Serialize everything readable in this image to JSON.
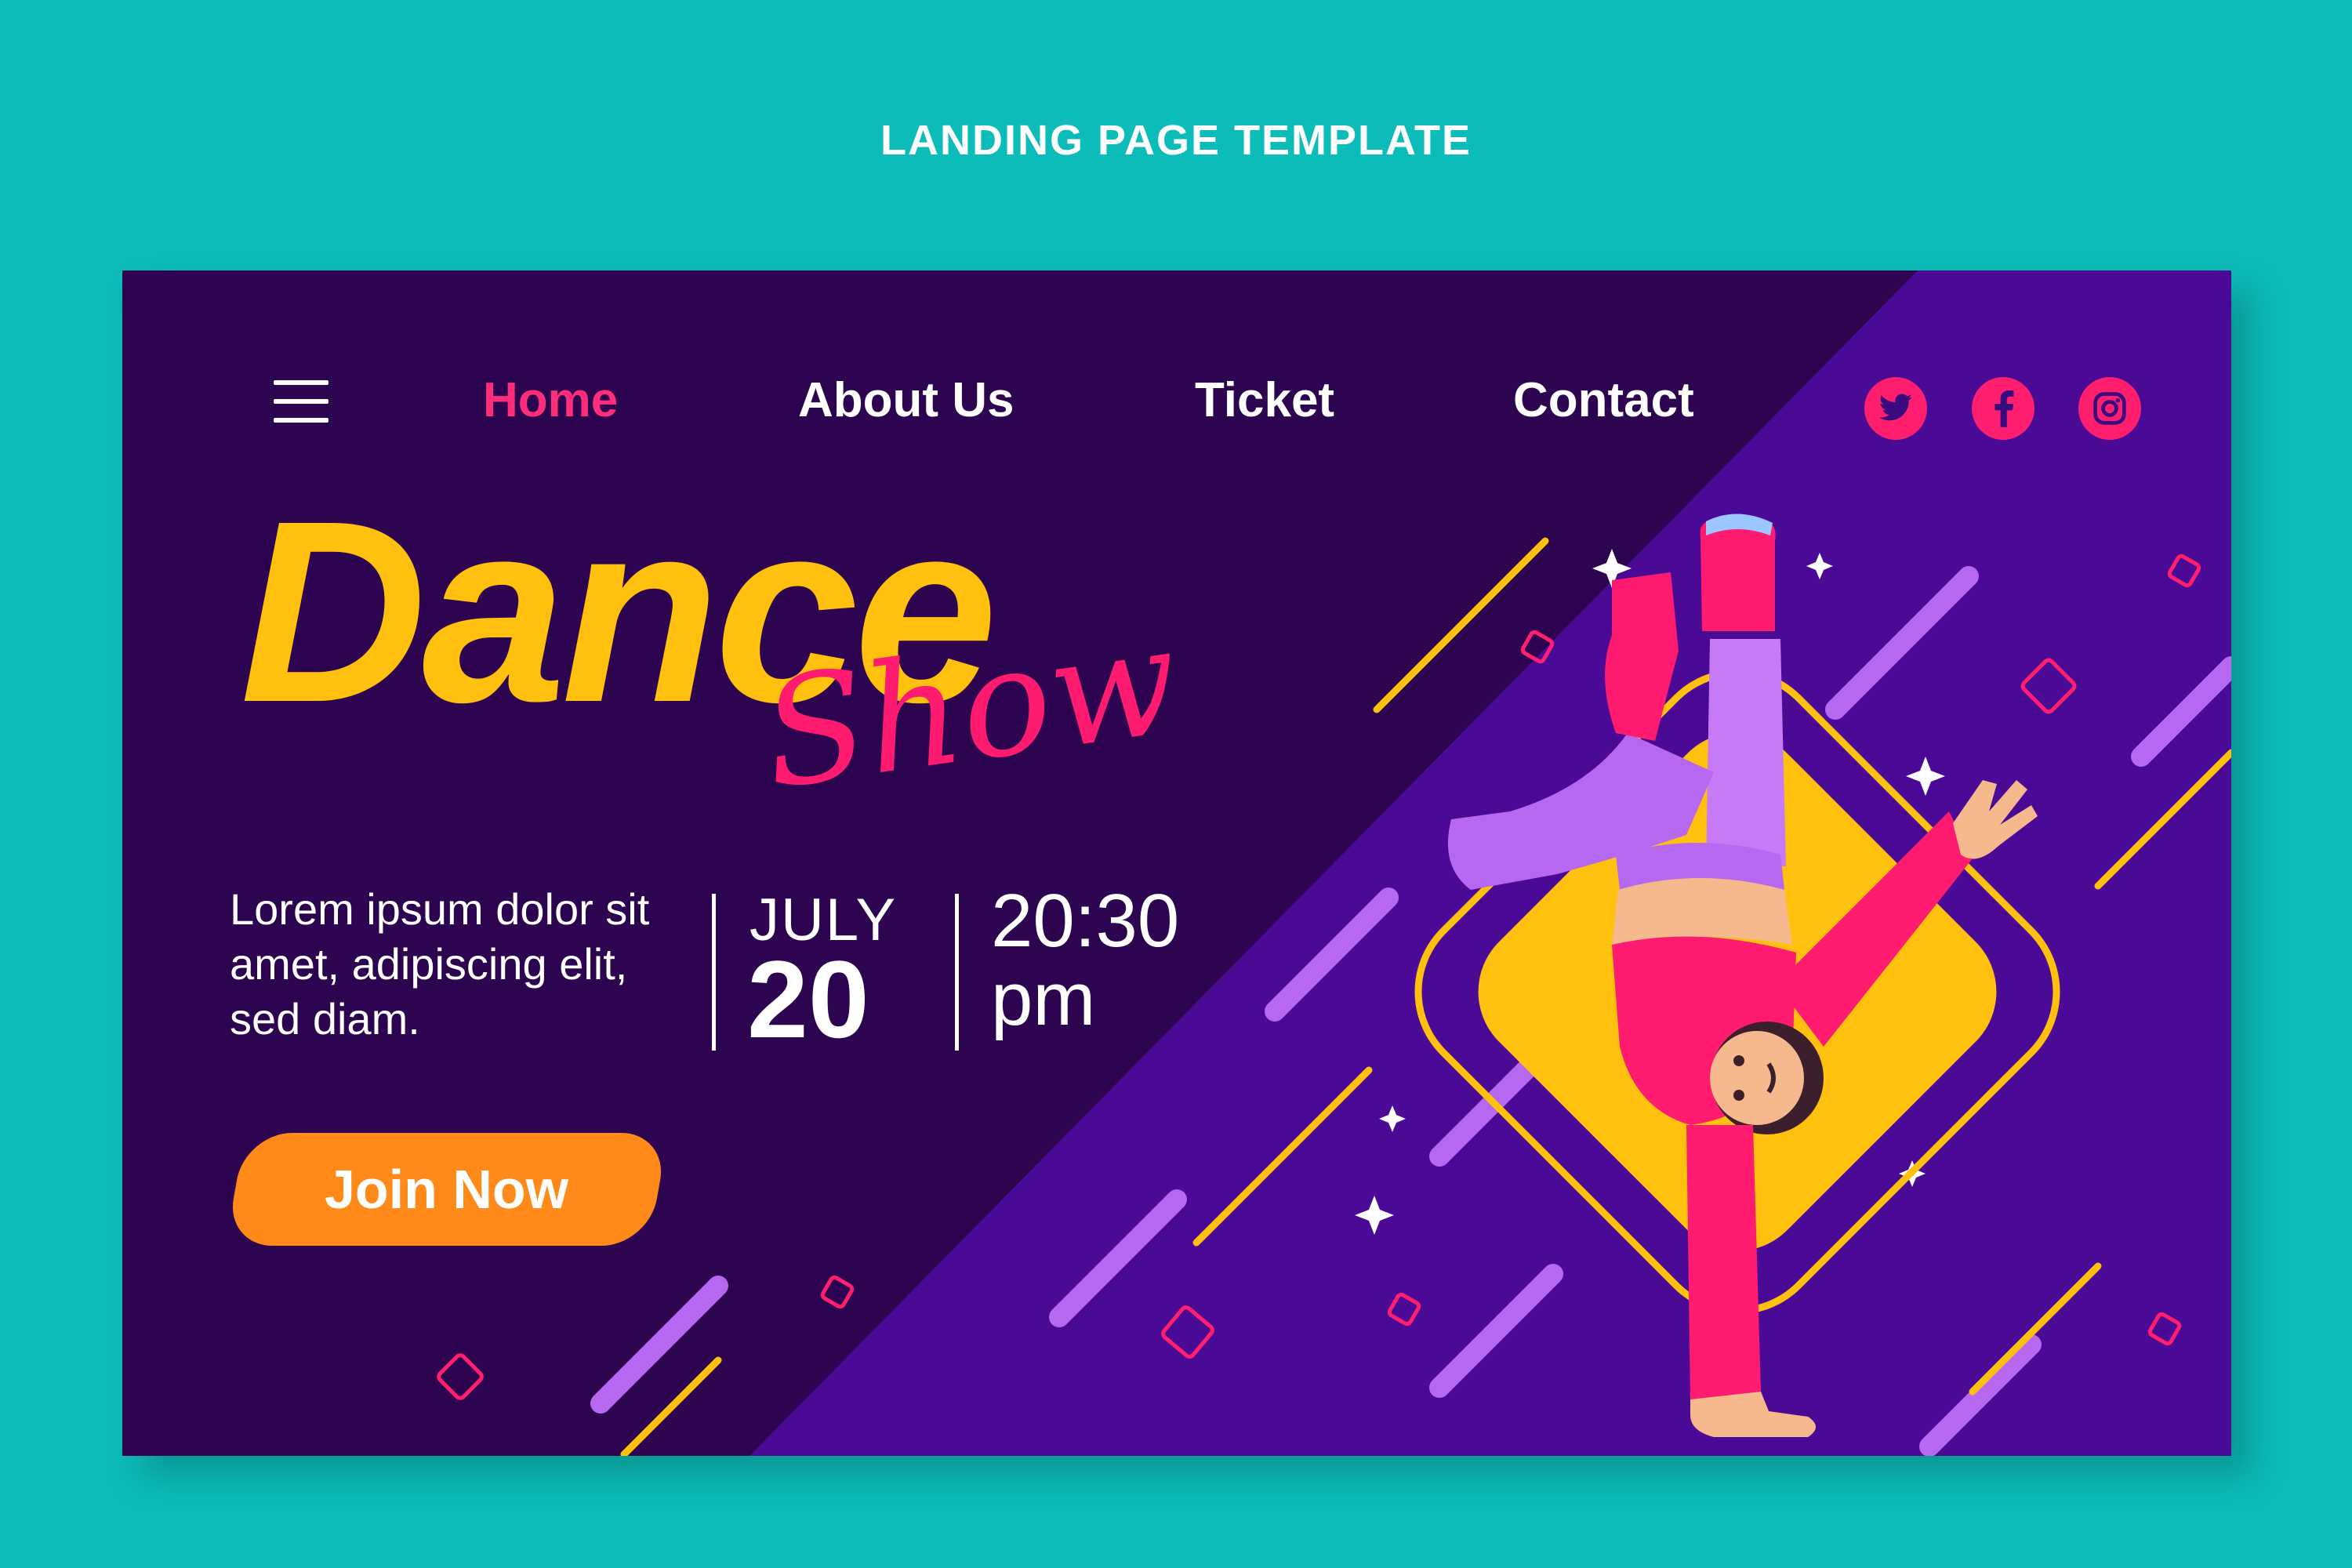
{
  "page": {
    "heading": "LANDING PAGE TEMPLATE"
  },
  "nav": {
    "menu_icon": "hamburger-menu-icon",
    "links": [
      {
        "label": "Home",
        "active": true
      },
      {
        "label": "About Us",
        "active": false
      },
      {
        "label": "Ticket",
        "active": false
      },
      {
        "label": "Contact",
        "active": false
      }
    ],
    "social": [
      {
        "icon": "twitter-icon"
      },
      {
        "icon": "facebook-icon"
      },
      {
        "icon": "instagram-icon"
      }
    ]
  },
  "hero": {
    "title_main": "Dance",
    "title_script": "Show",
    "description": "Lorem ipsum dolor sit amet, adipiscing elit, sed diam.",
    "date_month": "JULY",
    "date_day": "20",
    "time_value": "20:30",
    "time_period": "pm",
    "cta_label": "Join Now"
  },
  "colors": {
    "page_bg": "#0cbcb8",
    "card_dark": "#2c0450",
    "card_purple": "#4a0a96",
    "accent_yellow": "#ffc10e",
    "accent_pink": "#ff1b6f",
    "accent_orange": "#ff8a19",
    "accent_lavender": "#b768f0"
  },
  "illustration": {
    "subject": "breakdancer-illustration"
  }
}
